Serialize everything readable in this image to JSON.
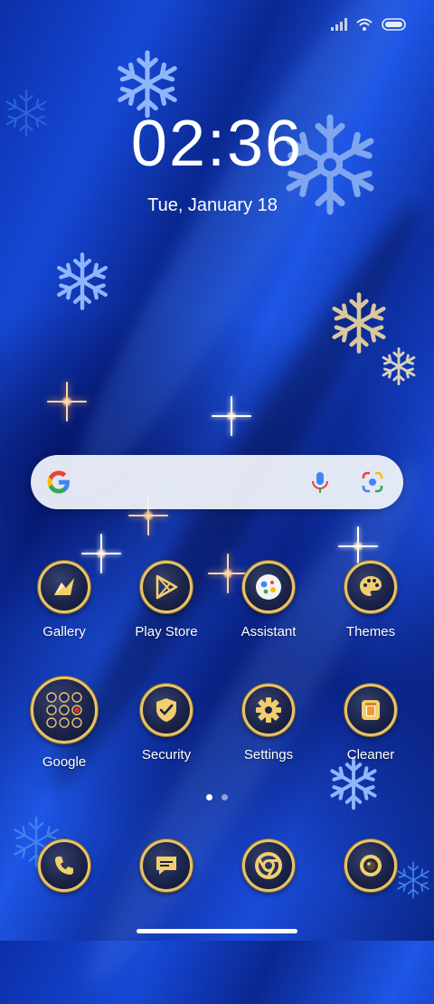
{
  "status_bar": {
    "signal_icon": "signal-icon",
    "wifi_icon": "wifi-icon",
    "battery_icon": "battery-icon"
  },
  "clock": {
    "time": "02:36",
    "date": "Tue, January 18"
  },
  "search": {
    "google_icon": "google-g-icon",
    "mic_icon": "mic-icon",
    "lens_icon": "google-lens-icon"
  },
  "apps": {
    "row1": [
      {
        "label": "Gallery",
        "icon": "gallery-icon"
      },
      {
        "label": "Play Store",
        "icon": "play-store-icon"
      },
      {
        "label": "Assistant",
        "icon": "assistant-icon"
      },
      {
        "label": "Themes",
        "icon": "palette-icon"
      }
    ],
    "row2": [
      {
        "label": "Google",
        "icon": "google-folder-icon"
      },
      {
        "label": "Security",
        "icon": "shield-check-icon"
      },
      {
        "label": "Settings",
        "icon": "gear-icon"
      },
      {
        "label": "Cleaner",
        "icon": "trash-icon"
      }
    ]
  },
  "page_indicator": {
    "pages": 2,
    "current": 1
  },
  "dock": [
    "phone-icon",
    "messages-icon",
    "chrome-icon",
    "camera-icon"
  ],
  "colors": {
    "gold": "#e8c46a",
    "wallpaper_blue": "#1648d6"
  }
}
